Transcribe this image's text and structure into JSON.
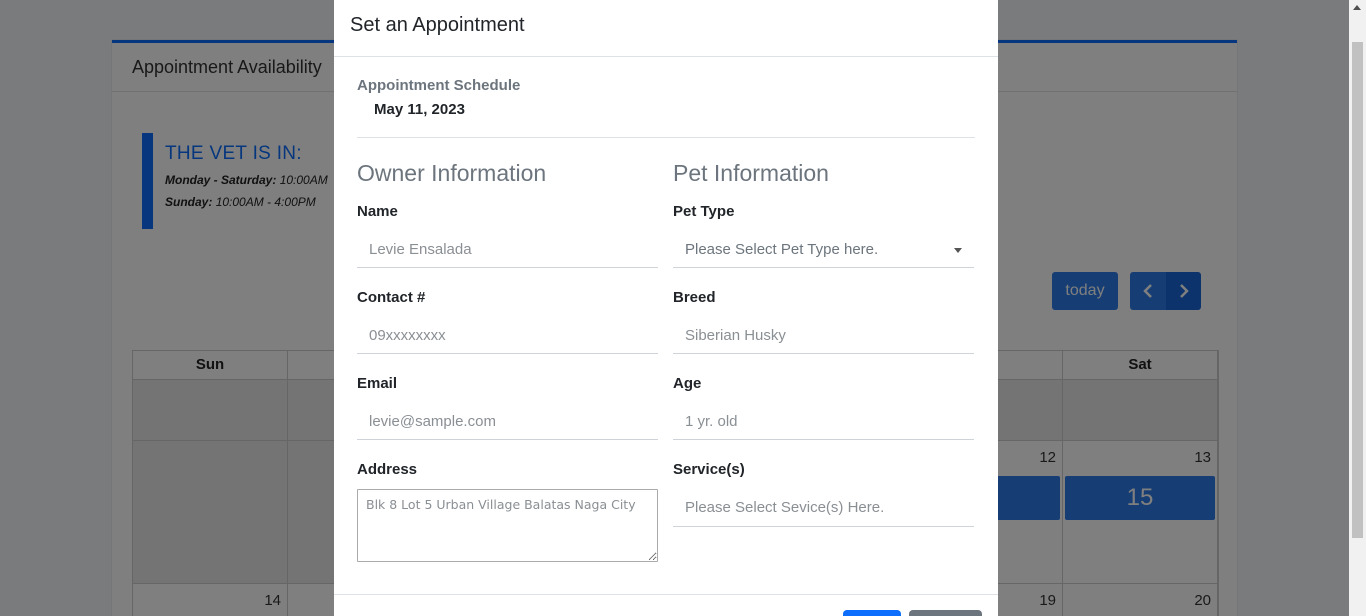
{
  "background": {
    "card_title": "Appointment Availability",
    "callout": {
      "title": "THE VET IS IN:",
      "line1_label": "Monday - Saturday:",
      "line1_value": "10:00AM",
      "line2_label": "Sunday:",
      "line2_value": "10:00AM - 4:00PM"
    },
    "calendar": {
      "today_label": "today",
      "days": [
        "Sun",
        "",
        "",
        "",
        "",
        "",
        "Sat"
      ],
      "week2": {
        "fri_num": "12",
        "sat_num": "13",
        "sat_event": "15"
      },
      "week3": {
        "sun_num": "14",
        "fri_num": "19",
        "sat_num": "20"
      }
    },
    "accent": "#2c7ce8"
  },
  "modal": {
    "title": "Set an Appointment",
    "schedule_label": "Appointment Schedule",
    "schedule_date": "May 11, 2023",
    "owner": {
      "section_title": "Owner Information",
      "name_label": "Name",
      "name_placeholder": "Levie Ensalada",
      "contact_label": "Contact #",
      "contact_placeholder": "09xxxxxxxx",
      "email_label": "Email",
      "email_placeholder": "levie@sample.com",
      "address_label": "Address",
      "address_placeholder": "Blk 8 Lot 5 Urban Village Balatas Naga City"
    },
    "pet": {
      "section_title": "Pet Information",
      "type_label": "Pet Type",
      "type_placeholder": "Please Select Pet Type here.",
      "breed_label": "Breed",
      "breed_placeholder": "Siberian Husky",
      "age_label": "Age",
      "age_placeholder": "1 yr. old",
      "services_label": "Service(s)",
      "services_placeholder": "Please Select Sevice(s) Here."
    }
  }
}
